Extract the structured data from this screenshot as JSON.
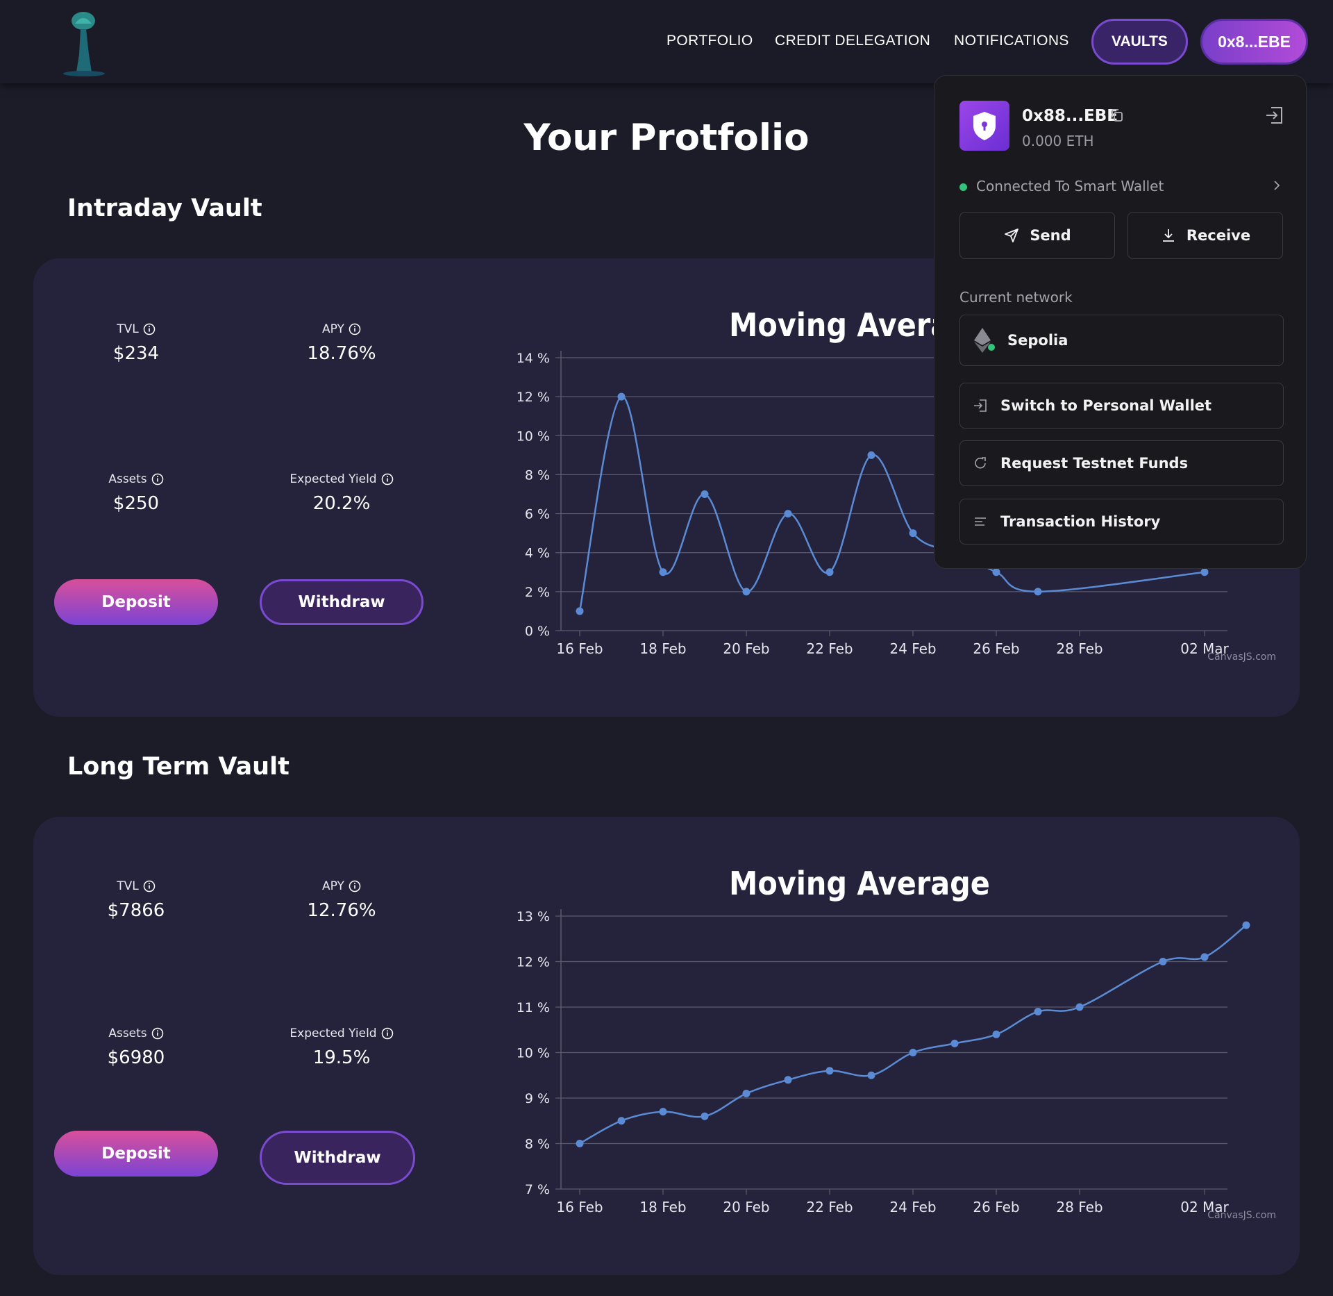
{
  "header": {
    "nav": [
      "PORTFOLIO",
      "CREDIT DELEGATION",
      "NOTIFICATIONS"
    ],
    "vaults_label": "VAULTS",
    "wallet_label": "0x8...EBE"
  },
  "page_title": "Your Protfolio",
  "vaults": [
    {
      "title": "Intraday Vault",
      "tvl_label": "TVL",
      "tvl": "$234",
      "apy_label": "APY",
      "apy": "18.76%",
      "assets_label": "Assets",
      "assets": "$250",
      "yield_label": "Expected Yield",
      "yield": "20.2%",
      "deposit_label": "Deposit",
      "withdraw_label": "Withdraw"
    },
    {
      "title": "Long Term Vault",
      "tvl_label": "TVL",
      "tvl": "$7866",
      "apy_label": "APY",
      "apy": "12.76%",
      "assets_label": "Assets",
      "assets": "$6980",
      "yield_label": "Expected Yield",
      "yield": "19.5%",
      "deposit_label": "Deposit",
      "withdraw_label": "Withdraw"
    }
  ],
  "chart_data": [
    {
      "type": "line",
      "title": "Moving Average",
      "credit": "CanvasJS.com",
      "x_ticks": [
        "16 Feb",
        "18 Feb",
        "20 Feb",
        "22 Feb",
        "24 Feb",
        "26 Feb",
        "28 Feb",
        "02 Mar"
      ],
      "y_ticks": [
        "0 %",
        "2 %",
        "4 %",
        "6 %",
        "8 %",
        "10 %",
        "12 %",
        "14 %"
      ],
      "ylim": [
        0,
        14
      ],
      "x": [
        "16 Feb",
        "17 Feb",
        "18 Feb",
        "19 Feb",
        "20 Feb",
        "21 Feb",
        "22 Feb",
        "23 Feb",
        "24 Feb",
        "25 Feb",
        "26 Feb",
        "27 Feb",
        "02 Mar"
      ],
      "values": [
        1,
        12,
        3,
        7,
        2,
        6,
        3,
        9,
        5,
        4,
        3,
        2,
        3
      ],
      "color": "#5b8bd4"
    },
    {
      "type": "line",
      "title": "Moving Average",
      "credit": "CanvasJS.com",
      "x_ticks": [
        "16 Feb",
        "18 Feb",
        "20 Feb",
        "22 Feb",
        "24 Feb",
        "26 Feb",
        "28 Feb",
        "02 Mar"
      ],
      "y_ticks": [
        "7 %",
        "8 %",
        "9 %",
        "10 %",
        "11 %",
        "12 %",
        "13 %"
      ],
      "ylim": [
        7,
        13
      ],
      "x": [
        "16 Feb",
        "17 Feb",
        "18 Feb",
        "19 Feb",
        "20 Feb",
        "21 Feb",
        "22 Feb",
        "23 Feb",
        "24 Feb",
        "25 Feb",
        "26 Feb",
        "27 Feb",
        "28 Feb",
        "01 Mar",
        "02 Mar",
        "03 Mar"
      ],
      "values": [
        8,
        8.5,
        8.7,
        8.6,
        9.1,
        9.4,
        9.6,
        9.5,
        10,
        10.2,
        10.4,
        10.9,
        11,
        12,
        12.1,
        12.8
      ],
      "color": "#5b8bd4"
    }
  ],
  "wallet_dropdown": {
    "address": "0x88...EBE",
    "balance": "0.000 ETH",
    "connection": "Connected To Smart Wallet",
    "send": "Send",
    "receive": "Receive",
    "network_label": "Current network",
    "network": "Sepolia",
    "switch": "Switch to Personal Wallet",
    "faucet": "Request Testnet Funds",
    "history": "Transaction History"
  }
}
